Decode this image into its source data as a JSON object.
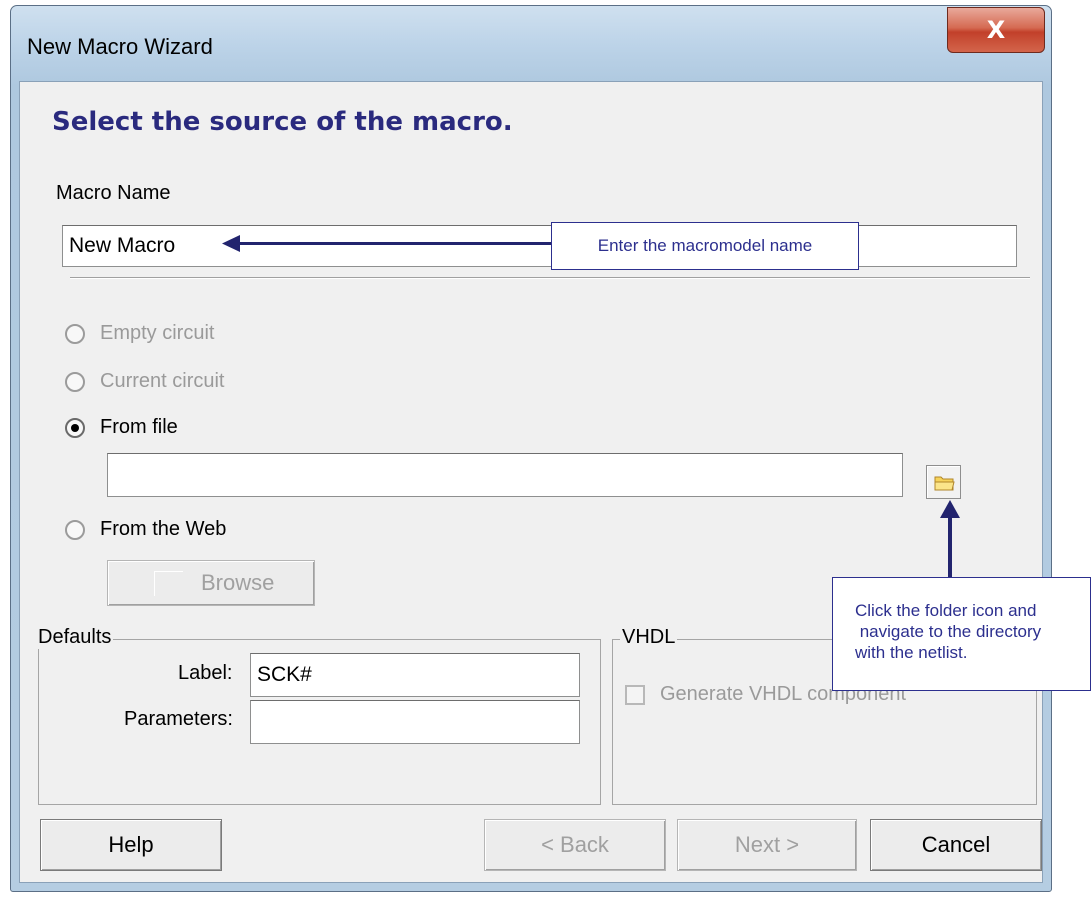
{
  "window": {
    "title": "New Macro Wizard",
    "close_label": "X"
  },
  "heading": "Select the source of the macro.",
  "macro_name": {
    "label": "Macro Name",
    "value": "New Macro"
  },
  "source_options": [
    {
      "label": "Empty circuit",
      "enabled": false,
      "selected": false
    },
    {
      "label": "Current circuit",
      "enabled": false,
      "selected": false
    },
    {
      "label": "From file",
      "enabled": true,
      "selected": true
    },
    {
      "label": "From the Web",
      "enabled": true,
      "selected": false
    }
  ],
  "file_path": {
    "value": ""
  },
  "browse_label": "Browse",
  "defaults": {
    "title": "Defaults",
    "label_caption": "Label:",
    "label_value": "SCK#",
    "parameters_caption": "Parameters:",
    "parameters_value": ""
  },
  "vhdl": {
    "title": "VHDL",
    "checkbox_label": "Generate VHDL component"
  },
  "buttons": {
    "help": "Help",
    "back": "< Back",
    "next": "Next >",
    "cancel": "Cancel"
  },
  "annotations": {
    "macro_name_callout": "Enter the macromodel name",
    "folder_callout_line1": "Click the folder icon and",
    "folder_callout_line2": " navigate to the directory",
    "folder_callout_line3": "with the netlist."
  },
  "colors": {
    "heading": "#2a2a7e",
    "annotation": "#2c2f8e",
    "close_button": "#c2402a"
  }
}
